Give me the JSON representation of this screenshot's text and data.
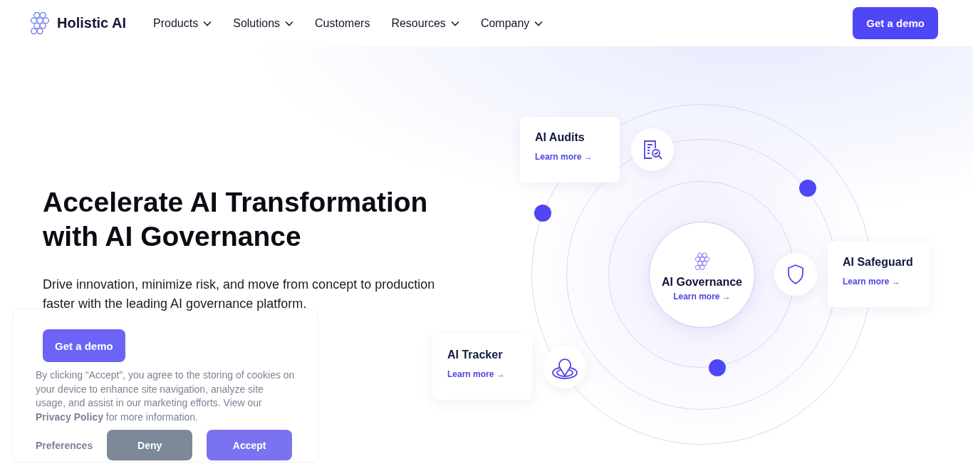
{
  "header": {
    "logo": "Holistic AI",
    "nav": [
      {
        "label": "Products",
        "dropdown": true
      },
      {
        "label": "Solutions",
        "dropdown": true
      },
      {
        "label": "Customers",
        "dropdown": false
      },
      {
        "label": "Resources",
        "dropdown": true
      },
      {
        "label": "Company",
        "dropdown": true
      }
    ],
    "cta": "Get a demo"
  },
  "hero": {
    "title": [
      "Accelerate AI Transformation",
      "with AI Governance"
    ],
    "subtitle": "Drive innovation, minimize risk, and move from concept to production faster with the leading AI governance platform.",
    "cta": "Get a demo"
  },
  "diagram": {
    "center": {
      "title": "AI Governance",
      "link": "Learn more",
      "arrow": "→"
    },
    "cards": [
      {
        "kind": "audit",
        "title": "AI Audits",
        "link": "Learn more",
        "arrow": "→"
      },
      {
        "kind": "safeguard",
        "title": "AI Safeguard",
        "link": "Learn more",
        "arrow": "→"
      },
      {
        "kind": "tracker",
        "title": "AI Tracker",
        "link": "Learn more",
        "arrow": "→"
      }
    ]
  },
  "cookie_banner": {
    "text_before": "By clicking “Accept”, you agree to the storing of cookies on your device to enhance site navigation, analyze site usage, and assist in our marketing efforts. View our",
    "link": "Privacy Policy",
    "text_after": "for more information.",
    "buttons": [
      {
        "kind": "text",
        "label": "Preferences"
      },
      {
        "kind": "deny",
        "label": "Deny"
      },
      {
        "kind": "accept",
        "label": "Accept"
      }
    ]
  }
}
